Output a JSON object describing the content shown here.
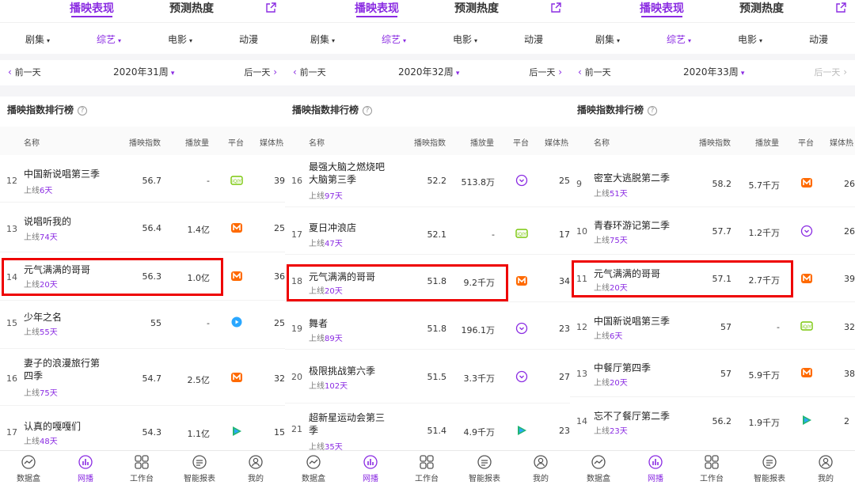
{
  "colors": {
    "accent": "#8a2be2",
    "highlight": "#e00000",
    "iqiyi": "#7ac70c",
    "mango": "#ff6a00",
    "youku": "#2aa7ff",
    "tencent": "#22b573"
  },
  "common": {
    "tabs": [
      "播映表现",
      "预测热度"
    ],
    "categories": [
      "剧集",
      "综艺",
      "电影",
      "动漫"
    ],
    "prev_label": "前一天",
    "next_label": "后一天",
    "rank_title": "播映指数排行榜",
    "qmark": "?",
    "columns": {
      "name": "名称",
      "index": "播映指数",
      "plays": "播放量",
      "platform": "平台",
      "media": "媒体热"
    },
    "bottom_nav": [
      "数据盒",
      "网播",
      "工作台",
      "智能报表",
      "我的"
    ]
  },
  "panels": [
    {
      "week": "2020年31周",
      "rows": [
        {
          "rank": "12",
          "title": "中国新说唱第三季",
          "online_prefix": "上线",
          "days": "6天",
          "index": "56.7",
          "plays": "-",
          "platform": "iqiyi-icon",
          "media": "39"
        },
        {
          "rank": "13",
          "title": "说唱听我的",
          "online_prefix": "上线",
          "days": "74天",
          "index": "56.4",
          "plays": "1.4亿",
          "platform": "mango-icon",
          "media": "25"
        },
        {
          "rank": "14",
          "title": "元气满满的哥哥",
          "online_prefix": "上线",
          "days": "20天",
          "index": "56.3",
          "plays": "1.0亿",
          "platform": "mango-icon",
          "media": "36"
        },
        {
          "rank": "15",
          "title": "少年之名",
          "online_prefix": "上线",
          "days": "55天",
          "index": "55",
          "plays": "-",
          "platform": "youku-icon",
          "media": "25"
        },
        {
          "rank": "16",
          "title": "妻子的浪漫旅行第四季",
          "online_prefix": "上线",
          "days": "75天",
          "index": "54.7",
          "plays": "2.5亿",
          "platform": "mango-icon",
          "media": "32"
        },
        {
          "rank": "17",
          "title": "认真的嘎嘎们",
          "online_prefix": "上线",
          "days": "48天",
          "index": "54.3",
          "plays": "1.1亿",
          "platform": "tencent-icon",
          "media": "15"
        }
      ]
    },
    {
      "week": "2020年32周",
      "rows": [
        {
          "rank": "16",
          "title": "最强大脑之燃烧吧大脑第三季",
          "online_prefix": "上线",
          "days": "97天",
          "index": "52.2",
          "plays": "513.8万",
          "platform": "youku-icon",
          "media": "25"
        },
        {
          "rank": "17",
          "title": "夏日冲浪店",
          "online_prefix": "上线",
          "days": "47天",
          "index": "52.1",
          "plays": "-",
          "platform": "iqiyi-icon",
          "media": "17"
        },
        {
          "rank": "18",
          "title": "元气满满的哥哥",
          "online_prefix": "上线",
          "days": "20天",
          "index": "51.8",
          "plays": "9.2千万",
          "platform": "mango-icon",
          "media": "34"
        },
        {
          "rank": "19",
          "title": "舞者",
          "online_prefix": "上线",
          "days": "89天",
          "index": "51.8",
          "plays": "196.1万",
          "platform": "youku-icon",
          "media": "23"
        },
        {
          "rank": "20",
          "title": "极限挑战第六季",
          "online_prefix": "上线",
          "days": "102天",
          "index": "51.5",
          "plays": "3.3千万",
          "platform": "youku-icon",
          "media": "27"
        },
        {
          "rank": "21",
          "title": "超新星运动会第三季",
          "online_prefix": "上线",
          "days": "35天",
          "index": "51.4",
          "plays": "4.9千万",
          "platform": "tencent-icon",
          "media": "23"
        }
      ]
    },
    {
      "week": "2020年33周",
      "rows": [
        {
          "rank": "9",
          "title": "密室大逃脱第二季",
          "online_prefix": "上线",
          "days": "51天",
          "index": "58.2",
          "plays": "5.7千万",
          "platform": "mango-icon",
          "media": "26"
        },
        {
          "rank": "10",
          "title": "青春环游记第二季",
          "online_prefix": "上线",
          "days": "75天",
          "index": "57.7",
          "plays": "1.2千万",
          "platform": "youku-icon",
          "media": "26"
        },
        {
          "rank": "11",
          "title": "元气满满的哥哥",
          "online_prefix": "上线",
          "days": "20天",
          "index": "57.1",
          "plays": "2.7千万",
          "platform": "mango-icon",
          "media": "39"
        },
        {
          "rank": "12",
          "title": "中国新说唱第三季",
          "online_prefix": "上线",
          "days": "6天",
          "index": "57",
          "plays": "-",
          "platform": "iqiyi-icon",
          "media": "32"
        },
        {
          "rank": "13",
          "title": "中餐厅第四季",
          "online_prefix": "上线",
          "days": "20天",
          "index": "57",
          "plays": "5.9千万",
          "platform": "mango-icon",
          "media": "38"
        },
        {
          "rank": "14",
          "title": "忘不了餐厅第二季",
          "online_prefix": "上线",
          "days": "23天",
          "index": "56.2",
          "plays": "1.9千万",
          "platform": "tencent-icon",
          "media": "2"
        }
      ]
    }
  ]
}
